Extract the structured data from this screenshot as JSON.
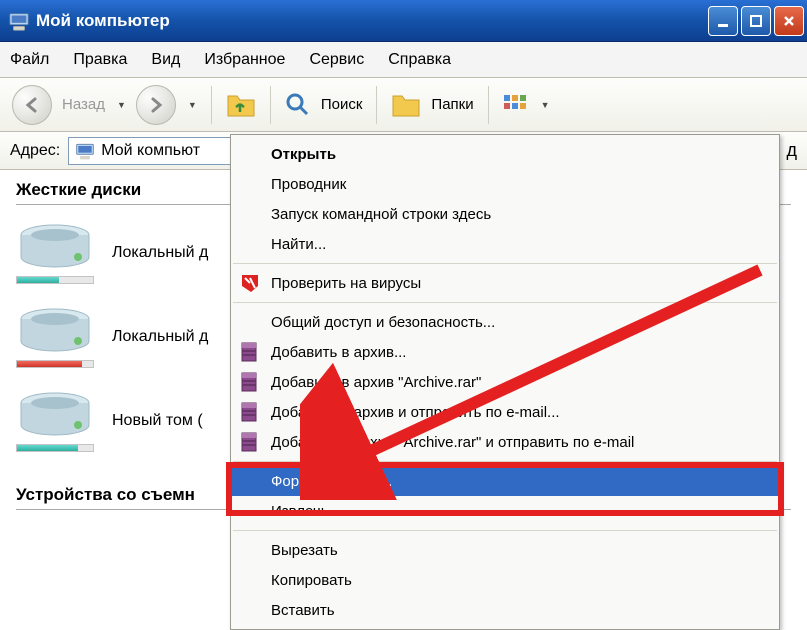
{
  "title": "Мой компьютер",
  "menu": [
    "Файл",
    "Правка",
    "Вид",
    "Избранное",
    "Сервис",
    "Справка"
  ],
  "toolbar": {
    "back": "Назад",
    "search": "Поиск",
    "folders": "Папки"
  },
  "addressbar": {
    "label": "Адрес:",
    "value": "Мой компьют"
  },
  "sections": {
    "drives": "Жесткие диски",
    "removable": "Устройства со съемн"
  },
  "drives": [
    {
      "label": "Локальный д",
      "fillColor": "teal",
      "fillPct": 55
    },
    {
      "label": "Локальный д",
      "fillColor": "red",
      "fillPct": 85
    },
    {
      "label": "Новый том (",
      "fillColor": "teal",
      "fillPct": 80
    }
  ],
  "rightEdgeLetter": "д",
  "context_menu": [
    {
      "label": "Открыть",
      "bold": true
    },
    {
      "label": "Проводник"
    },
    {
      "label": "Запуск командной строки здесь"
    },
    {
      "label": "Найти..."
    },
    {
      "sep": true
    },
    {
      "label": "Проверить на вирусы",
      "icon": "kav"
    },
    {
      "sep": true
    },
    {
      "label": "Общий доступ и безопасность..."
    },
    {
      "label": "Добавить в архив...",
      "icon": "rar"
    },
    {
      "label": "Добавить в архив \"Archive.rar\"",
      "icon": "rar"
    },
    {
      "label": "Добавить в архив и отправить по e-mail...",
      "icon": "rar",
      "truncated": true
    },
    {
      "label": "Добавить в архив \"Archive.rar\" и отправить по e-mail",
      "icon": "rar"
    },
    {
      "sep": true
    },
    {
      "label": "Форматировать...",
      "selected": true
    },
    {
      "label": "Извлечь"
    },
    {
      "sep": true
    },
    {
      "label": "Вырезать"
    },
    {
      "label": "Копировать"
    },
    {
      "label": "Вставить"
    }
  ]
}
